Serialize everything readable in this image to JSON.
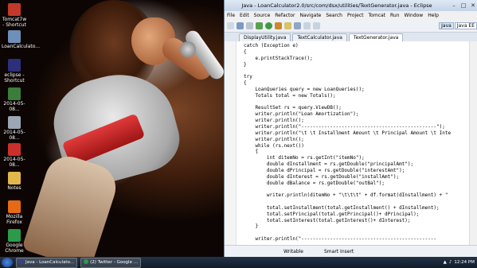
{
  "desktop": {
    "icons": [
      {
        "label": "Tomcat7w - Shortcut",
        "icon": "tomcat-icon",
        "color": "#c0392b"
      },
      {
        "label": "LoanCalculato...",
        "icon": "java-file-icon",
        "color": "#6d8fb8"
      },
      {
        "label": "eclipse - Shortcut",
        "icon": "eclipse-icon",
        "color": "#2c2f7a"
      },
      {
        "label": "2014-05-08...",
        "icon": "doc-file-icon",
        "color": "#3b7d3b"
      },
      {
        "label": "2014-05-08...",
        "icon": "doc-file-icon",
        "color": "#9da7b3"
      },
      {
        "label": "2014-05-08...",
        "icon": "pdf-file-icon",
        "color": "#c9302c"
      },
      {
        "label": "Notes",
        "icon": "folder-icon",
        "color": "#e3b84a"
      },
      {
        "label": "Mozilla Firefox",
        "icon": "firefox-icon",
        "color": "#e66a16"
      },
      {
        "label": "Google Chrome",
        "icon": "chrome-icon",
        "color": "#2b9b4a"
      }
    ]
  },
  "eclipse": {
    "title": "Java - LoanCalculator2.0/src/com/dsx/utilities/TextGenerator.java - Eclipse",
    "menu": [
      "File",
      "Edit",
      "Source",
      "Refactor",
      "Navigate",
      "Search",
      "Project",
      "Tomcat",
      "Run",
      "Window",
      "Help"
    ],
    "perspectives": [
      "Java",
      "Java EE"
    ],
    "tabs": [
      "DisplayUtility.java",
      "TextCalculator.java",
      "TextGenerator.java"
    ],
    "code": [
      "catch (Exception e)",
      "{",
      "    e.printStackTrace();",
      "}",
      "",
      "try",
      "{",
      "    LoanQueries query = new LoanQueries();",
      "    Totals total = new Totals();",
      "",
      "    ResultSet rs = query.ViewDB();",
      "    writer.println(\"Loan Amortization\");",
      "    writer.println();",
      "    writer.println(\"-----------------------------------------------\");",
      "    writer.println(\"\\t \\t Installment Amount \\t Principal Amount \\t Inte",
      "    writer.println();",
      "    while (rs.next())",
      "    {",
      "        int ditemNo = rs.getInt(\"itemNo\");",
      "        double dInstallment = rs.getDouble(\"principalAmt\");",
      "        double dPrincipal = rs.getDouble(\"interestAmt\");",
      "        double dInterest = rs.getDouble(\"installAmt\");",
      "        double dBalance = rs.getDouble(\"outBal\");",
      "",
      "        writer.println(ditemNo + \"\\t\\t\\t\" + df.format(dInstallment) + \"",
      "",
      "        total.setInstallment(total.getInstallment() + dInstallment);",
      "        total.setPrincipal(total.getPrincipal()+ dPrincipal);",
      "        total.setInterest(total.getInterest()+ dInterest);",
      "    }",
      "",
      "    writer.println(\"-----------------------------------------------"
    ],
    "status": {
      "writable": "Writable",
      "insert_mode": "Smart Insert"
    }
  },
  "taskbar": {
    "tasks": [
      {
        "label": "Java - LoanCalculato...",
        "icon": "eclipse-icon",
        "color": "#3b3f8f"
      },
      {
        "label": "(2) Twitter - Google ...",
        "icon": "chrome-icon",
        "color": "#2b9b4a"
      }
    ],
    "clock": "12:24 PM"
  }
}
